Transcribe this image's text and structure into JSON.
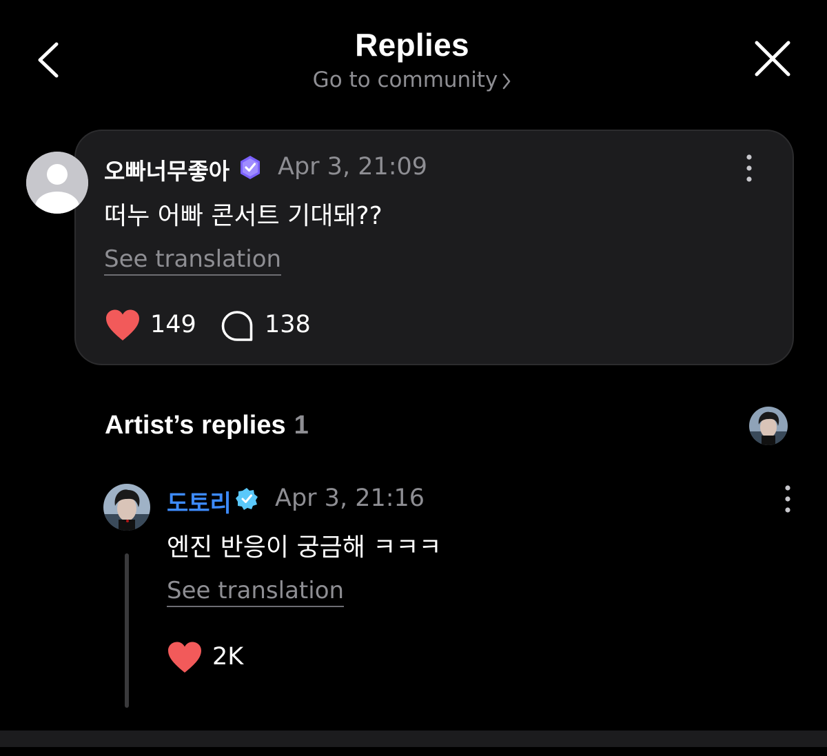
{
  "header": {
    "title": "Replies",
    "community_link": "Go to community"
  },
  "post": {
    "author": "오빠너무좋아",
    "time": "Apr 3, 21:09",
    "body": "떠누 어빠 콘서트 기대돼??",
    "translate_label": "See translation",
    "likes": "149",
    "comments": "138"
  },
  "artist_section": {
    "title": "Artist’s replies",
    "count": "1"
  },
  "reply": {
    "author": "도토리",
    "time": "Apr 3, 21:16",
    "body": "엔진 반응이 궁금해 ㅋㅋㅋ",
    "translate_label": "See translation",
    "likes": "2K"
  },
  "colors": {
    "background": "#000000",
    "card": "#1c1c1e",
    "secondary_text": "#8e8e93",
    "heart": "#f25a5a",
    "artist_name": "#3d8bff",
    "artist_badge": "#5ac8fa",
    "user_badge": "#7b61ff"
  },
  "icons": {
    "back": "chevron-left-icon",
    "close": "close-icon",
    "verified": "verified-badge-icon",
    "more": "more-vertical-icon",
    "like": "heart-icon",
    "comment": "comment-bubble-icon"
  }
}
